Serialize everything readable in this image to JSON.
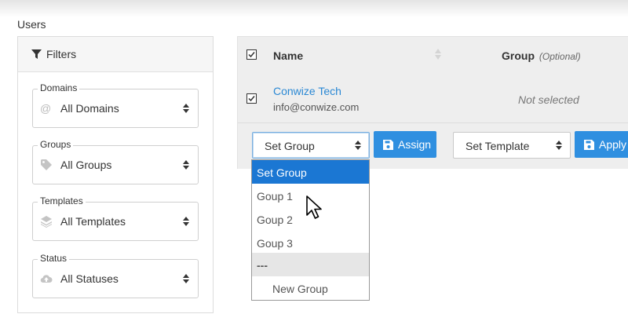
{
  "page": {
    "title": "Users"
  },
  "filters": {
    "title": "Filters",
    "domains": {
      "legend": "Domains",
      "value": "All Domains",
      "icon": "at-icon"
    },
    "groups": {
      "legend": "Groups",
      "value": "All Groups",
      "icon": "tag-icon"
    },
    "templates": {
      "legend": "Templates",
      "value": "All Templates",
      "icon": "layers-icon"
    },
    "status": {
      "legend": "Status",
      "value": "All Statuses",
      "icon": "cloud-upload-icon"
    }
  },
  "table": {
    "columns": {
      "name": "Name",
      "group": "Group",
      "group_hint": "(Optional)"
    },
    "rows": [
      {
        "name": "Conwize Tech",
        "email": "info@conwize.com",
        "group": "Not selected",
        "checked": true
      }
    ]
  },
  "actions": {
    "group_select_value": "Set Group",
    "assign_label": "Assign",
    "template_select_value": "Set Template",
    "apply_label": "Apply"
  },
  "group_dropdown": {
    "options": [
      "Set Group",
      "Goup 1",
      "Goup 2",
      "Goup 3",
      "---",
      "New Group"
    ],
    "selected": "Set Group"
  },
  "colors": {
    "accent": "#2f8fe0",
    "selected_option": "#1b77d3",
    "link": "#2a88d4"
  }
}
